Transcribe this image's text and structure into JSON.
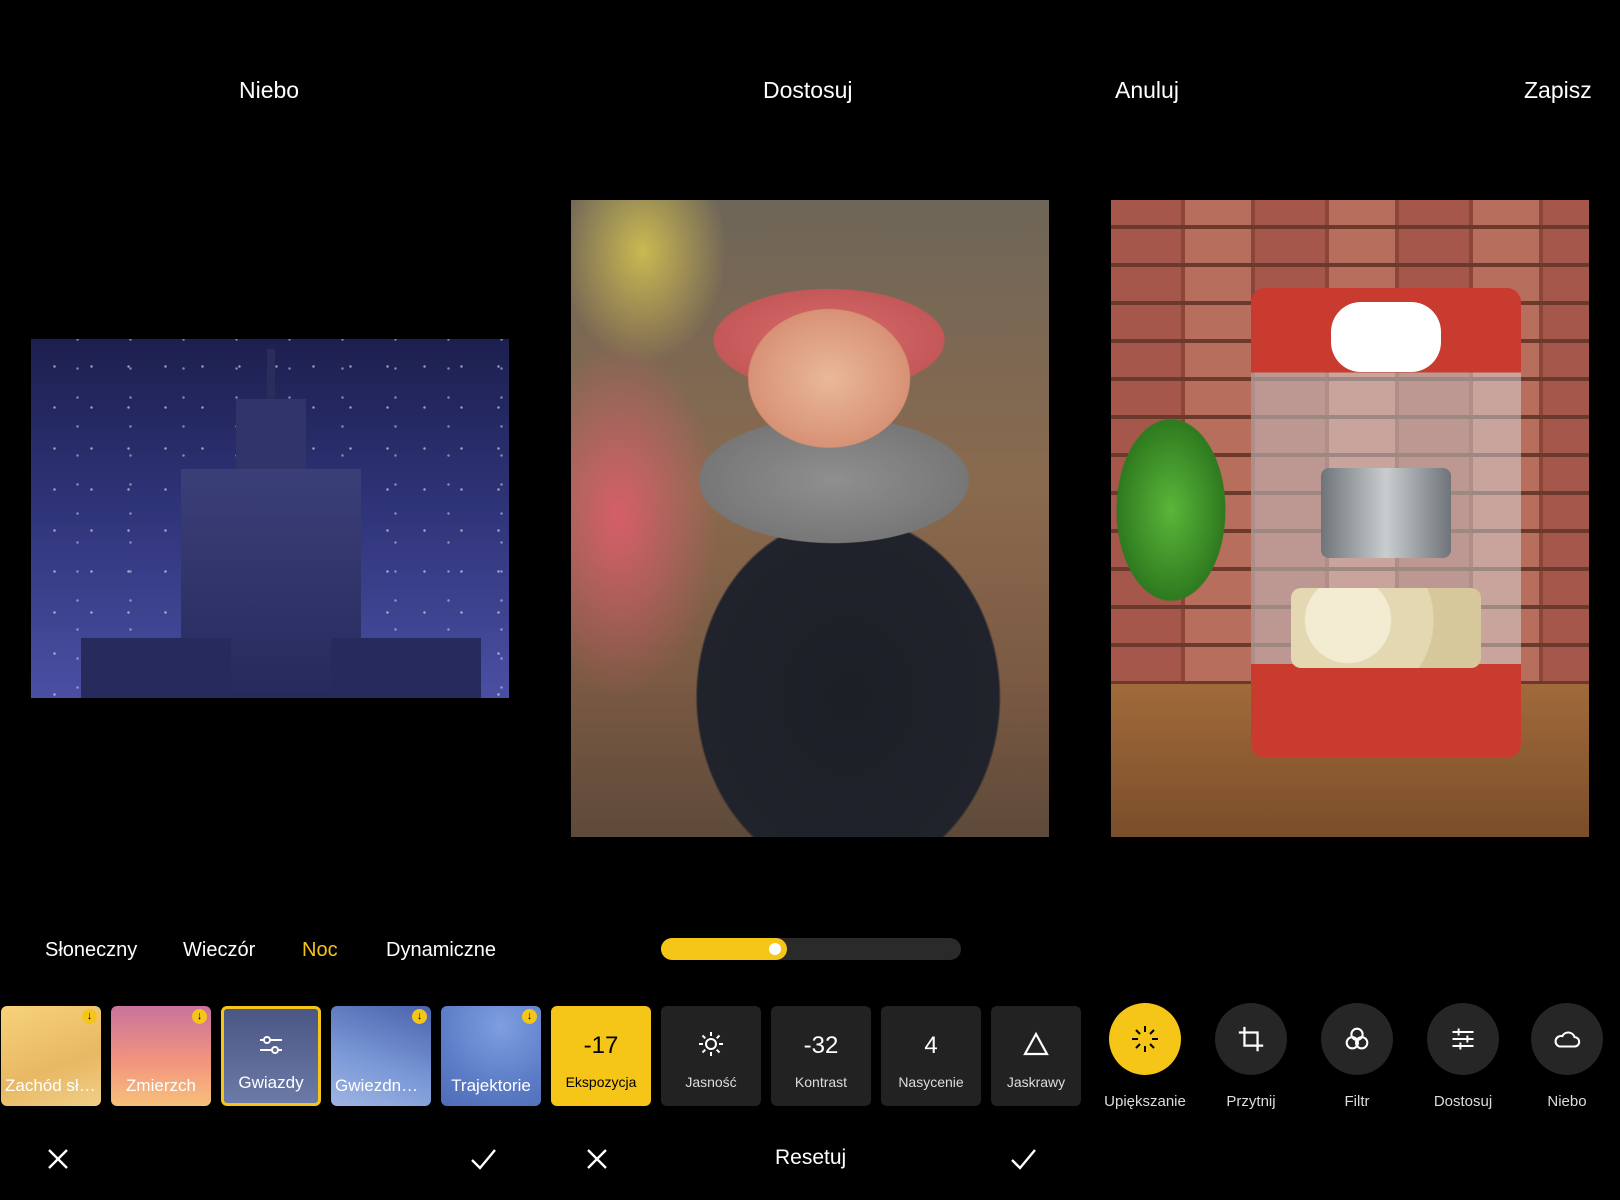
{
  "panels": {
    "sky": {
      "title": "Niebo",
      "categories": [
        {
          "label": "Słoneczny",
          "active": false
        },
        {
          "label": "Wieczór",
          "active": false
        },
        {
          "label": "Noc",
          "active": true
        },
        {
          "label": "Dynamiczne",
          "active": false
        }
      ],
      "presets": [
        {
          "label": "Zachód sło...",
          "download": true
        },
        {
          "label": "Zmierzch",
          "download": true
        },
        {
          "label": "Gwiazdy",
          "selected": true
        },
        {
          "label": "Gwiezdna ś...",
          "download": true
        },
        {
          "label": "Trajektorie",
          "download": true
        }
      ]
    },
    "adjust": {
      "title": "Dostosuj",
      "slider_fraction": 0.42,
      "reset_label": "Resetuj",
      "controls": [
        {
          "value": "-17",
          "label": "Ekspozycja",
          "active": true
        },
        {
          "icon": "sun-icon",
          "label": "Jasność"
        },
        {
          "value": "-32",
          "label": "Kontrast"
        },
        {
          "value": "4",
          "label": "Nasycenie"
        },
        {
          "icon": "triangle-icon",
          "label": "Jaskrawy"
        }
      ]
    },
    "tools": {
      "cancel_label": "Anuluj",
      "save_label": "Zapisz",
      "items": [
        {
          "icon": "sparkle-icon",
          "label": "Upiększanie",
          "active": true
        },
        {
          "icon": "crop-icon",
          "label": "Przytnij"
        },
        {
          "icon": "filter-icon",
          "label": "Filtr"
        },
        {
          "icon": "sliders-icon",
          "label": "Dostosuj"
        },
        {
          "icon": "cloud-icon",
          "label": "Niebo"
        }
      ]
    }
  },
  "colors": {
    "accent": "#f5c518",
    "background": "#000000",
    "tile": "#222222"
  }
}
